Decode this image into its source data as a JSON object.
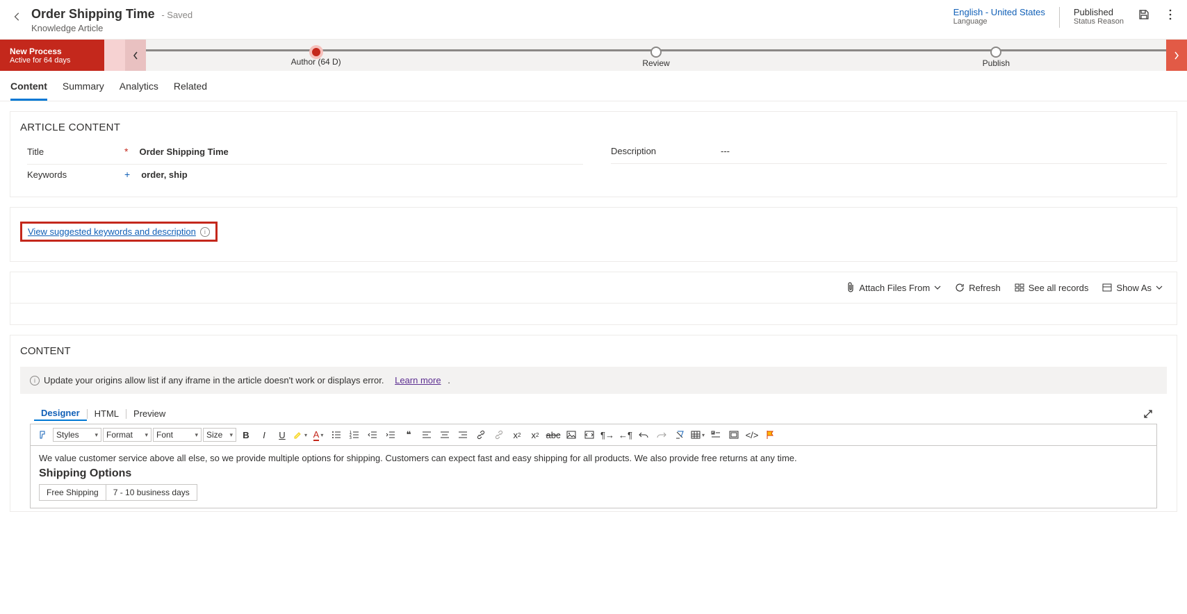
{
  "header": {
    "title": "Order Shipping Time",
    "saved": "- Saved",
    "subtitle": "Knowledge Article",
    "language": {
      "value": "English - United States",
      "label": "Language"
    },
    "status": {
      "value": "Published",
      "label": "Status Reason"
    }
  },
  "process": {
    "name": "New Process",
    "sub": "Active for 64 days",
    "stages": [
      {
        "label": "Author  (64 D)",
        "active": true
      },
      {
        "label": "Review",
        "active": false
      },
      {
        "label": "Publish",
        "active": false
      }
    ]
  },
  "tabs": [
    "Content",
    "Summary",
    "Analytics",
    "Related"
  ],
  "article": {
    "section": "ARTICLE CONTENT",
    "fields": {
      "title": {
        "label": "Title",
        "value": "Order Shipping Time"
      },
      "keywords": {
        "label": "Keywords",
        "value": "order, ship"
      },
      "description": {
        "label": "Description",
        "value": "---"
      }
    }
  },
  "suggest": {
    "link": "View suggested keywords and description"
  },
  "fileToolbar": {
    "attach": "Attach Files From",
    "refresh": "Refresh",
    "seeAll": "See all records",
    "showAs": "Show As"
  },
  "contentSection": {
    "title": "CONTENT",
    "alert": "Update your origins allow list if any iframe in the article doesn't work or displays error.",
    "learnMore": "Learn more",
    "tabs": [
      "Designer",
      "HTML",
      "Preview"
    ],
    "rteSelects": {
      "styles": "Styles",
      "format": "Format",
      "font": "Font",
      "size": "Size"
    },
    "bodyIntro": "We value customer service above all else, so we provide multiple options for shipping. Customers can expect fast and easy shipping for all products. We also provide free returns at any time.",
    "bodyHeading": "Shipping Options",
    "table": {
      "col1": "Free Shipping",
      "col2": "7 - 10 business days"
    }
  }
}
